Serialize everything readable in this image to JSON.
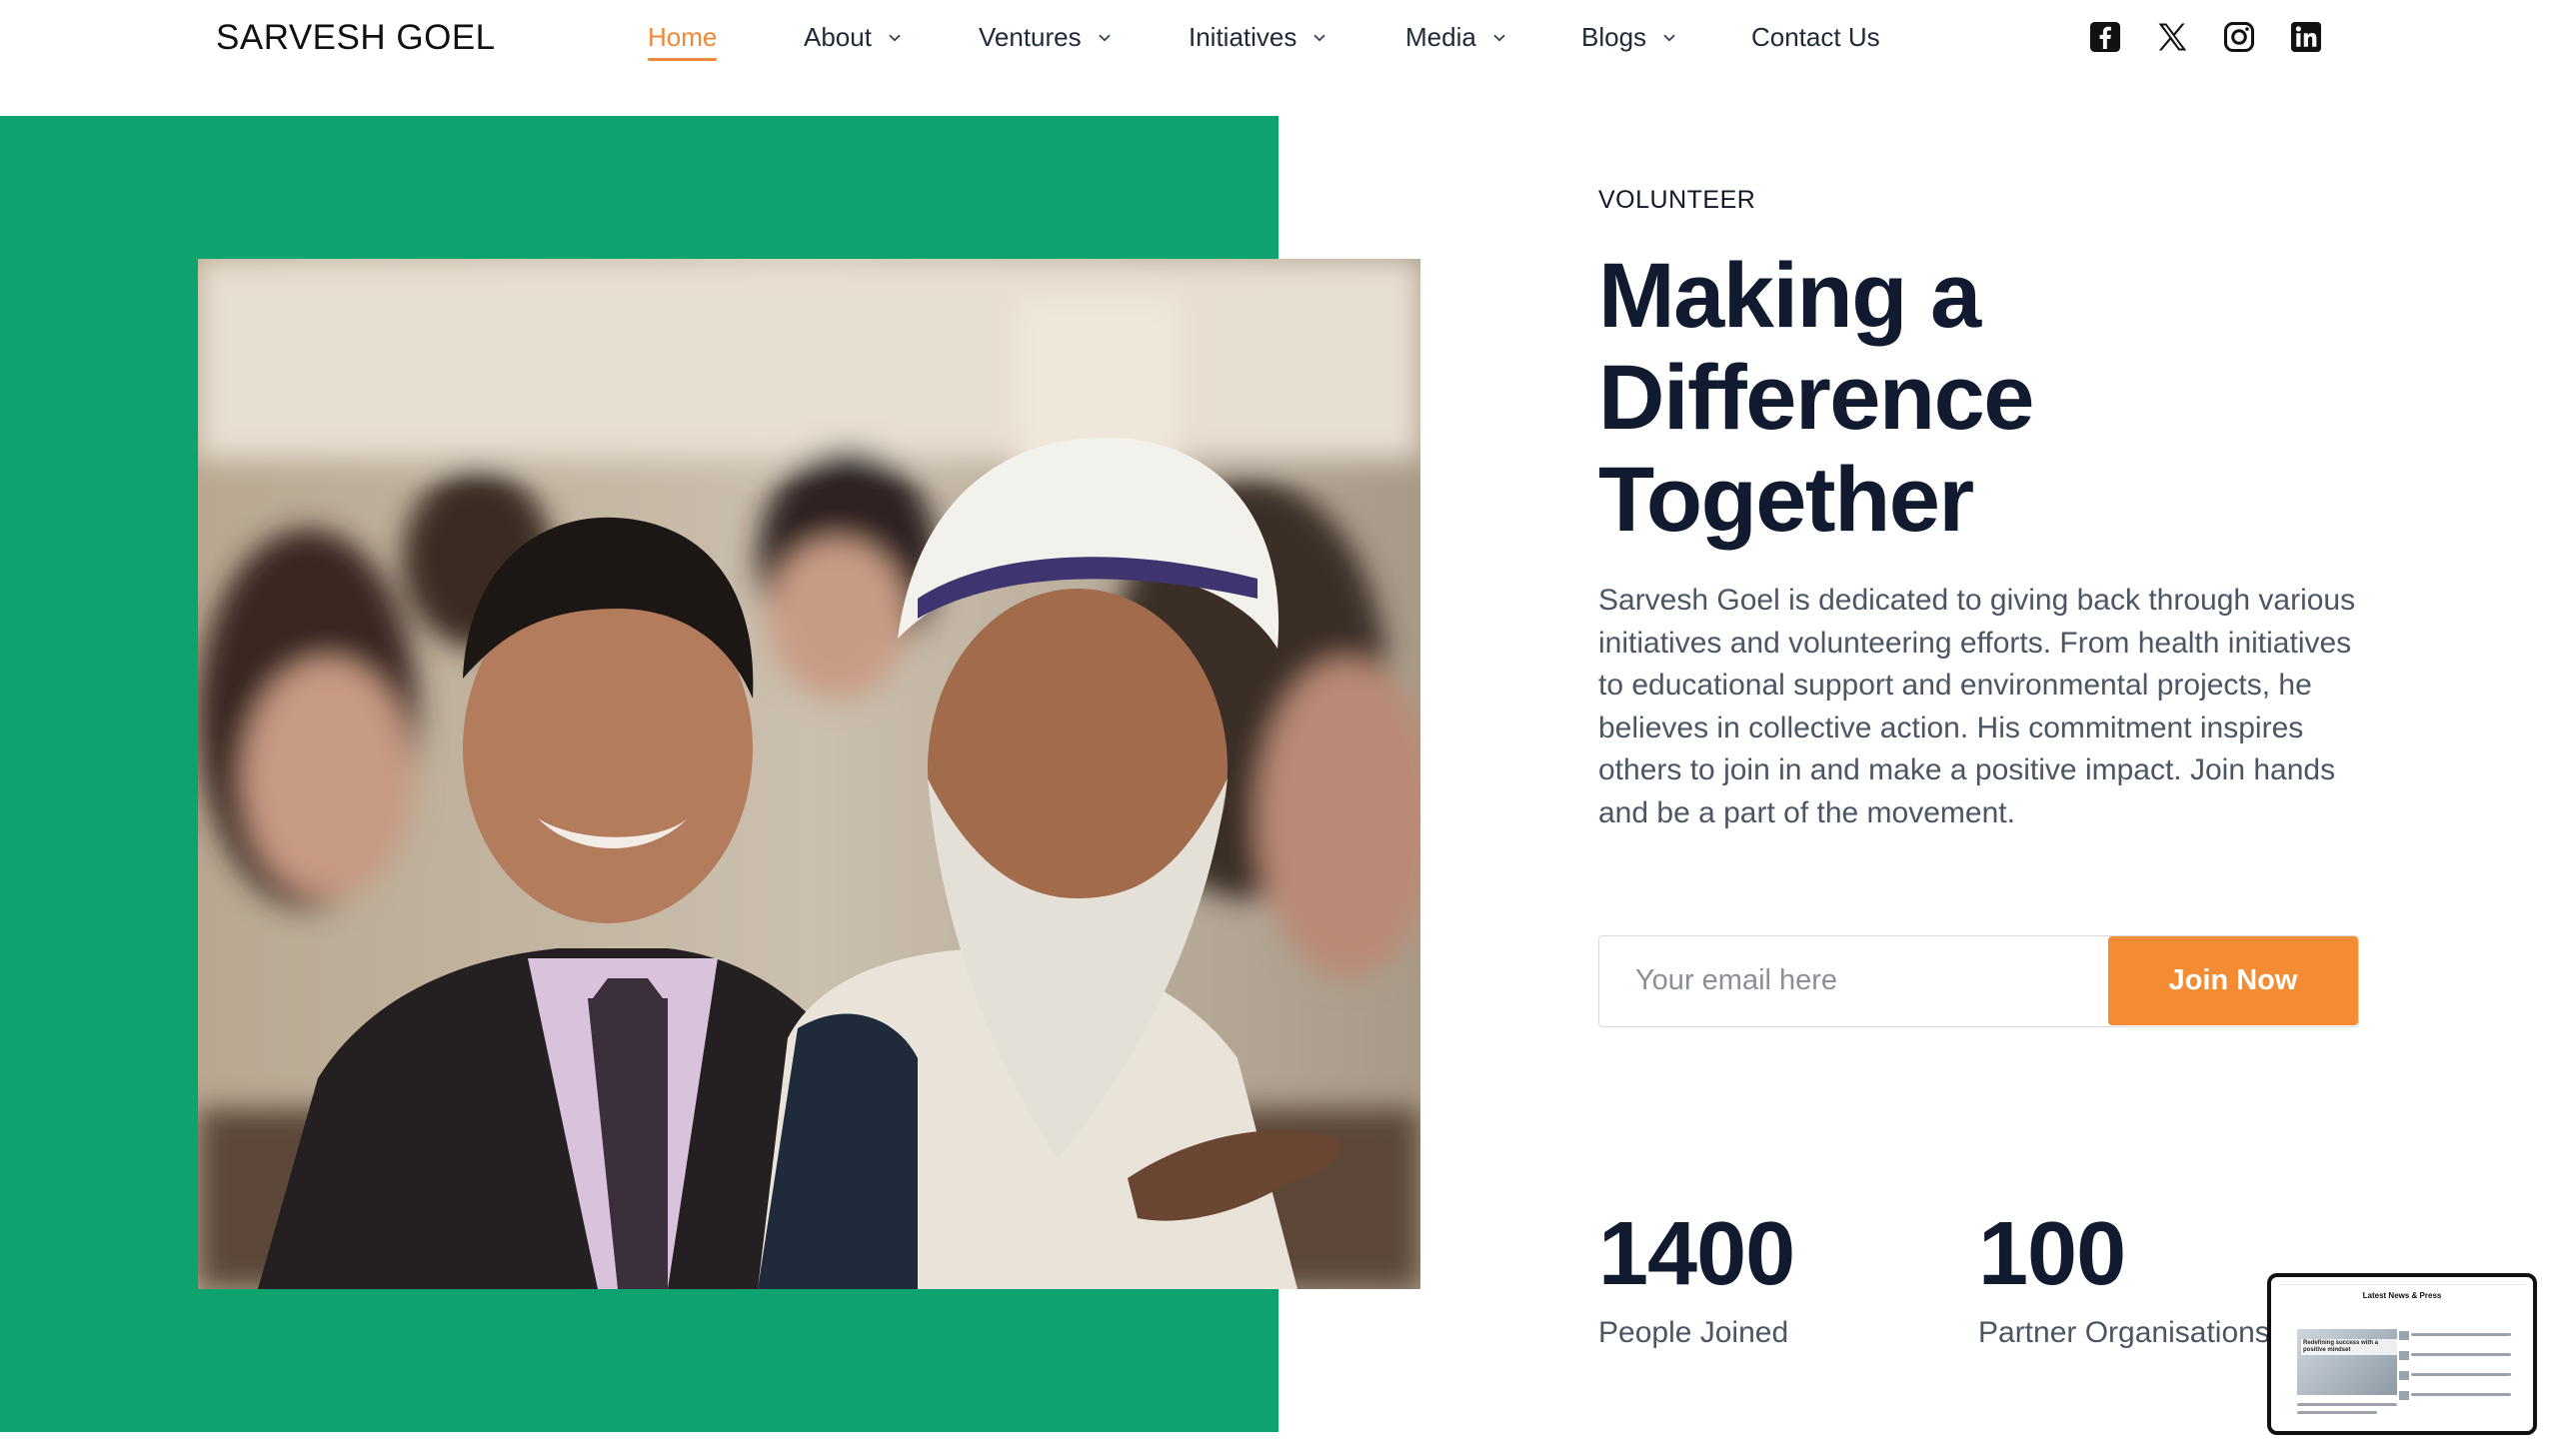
{
  "header": {
    "logo": "SARVESH GOEL",
    "nav": [
      {
        "label": "Home",
        "active": true,
        "has_dropdown": false
      },
      {
        "label": "About",
        "active": false,
        "has_dropdown": true
      },
      {
        "label": "Ventures",
        "active": false,
        "has_dropdown": true
      },
      {
        "label": "Initiatives",
        "active": false,
        "has_dropdown": true
      },
      {
        "label": "Media",
        "active": false,
        "has_dropdown": true
      },
      {
        "label": "Blogs",
        "active": false,
        "has_dropdown": true
      },
      {
        "label": "Contact Us",
        "active": false,
        "has_dropdown": false
      }
    ],
    "socials": [
      "facebook-icon",
      "x-icon",
      "instagram-icon",
      "linkedin-icon"
    ]
  },
  "hero": {
    "eyebrow": "VOLUNTEER",
    "headline": "Making a Difference Together",
    "description": "Sarvesh Goel is dedicated to giving back through various initiatives and volunteering efforts. From health initiatives to educational support and environmental projects, he believes in collective action. His commitment inspires others to join in and make a positive impact. Join hands and be a part of the movement.",
    "email_placeholder": "Your email here",
    "email_value": "",
    "join_label": "Join Now"
  },
  "stats": [
    {
      "number": "1400",
      "label": "People Joined"
    },
    {
      "number": "100",
      "label": "Partner Organisations"
    }
  ],
  "preview": {
    "title": "Latest News & Press",
    "badge": "Redefining success with a positive mindset"
  },
  "colors": {
    "accent": "#f48c34",
    "green_panel": "#0ca36f",
    "heading": "#111a2e",
    "body_text": "#4b5563"
  }
}
